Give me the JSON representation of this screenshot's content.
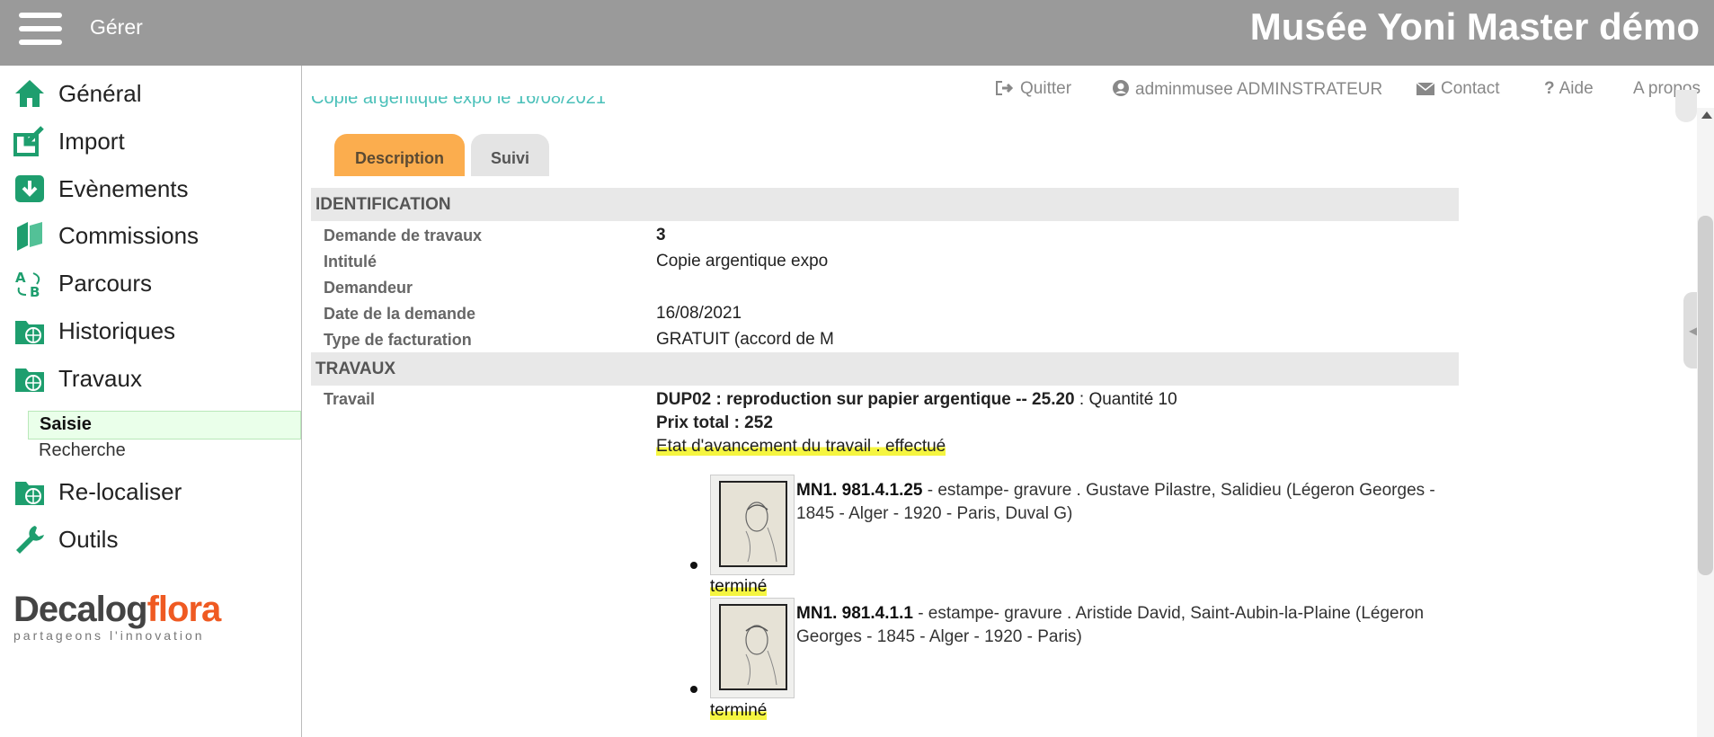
{
  "header": {
    "menu_label": "Gérer",
    "app_title": "Musée Yoni Master démo",
    "bar_color": "#9a9a9a"
  },
  "sidebar": {
    "items": [
      {
        "label": "Général",
        "icon": "home-icon"
      },
      {
        "label": "Import",
        "icon": "import-icon"
      },
      {
        "label": "Evènements",
        "icon": "download-box-icon"
      },
      {
        "label": "Commissions",
        "icon": "books-icon"
      },
      {
        "label": "Parcours",
        "icon": "route-ab-icon"
      },
      {
        "label": "Historiques",
        "icon": "folder-globe-icon"
      },
      {
        "label": "Travaux",
        "icon": "folder-globe-icon"
      },
      {
        "label": "Re-localiser",
        "icon": "folder-globe-icon"
      },
      {
        "label": "Outils",
        "icon": "wrench-icon"
      }
    ],
    "sub_items": [
      {
        "label": "Saisie",
        "active": true
      },
      {
        "label": "Recherche",
        "active": false
      }
    ],
    "accent_color": "#1e9e6e"
  },
  "logo": {
    "part1": "Decalog",
    "part2": "flora",
    "tagline": "partageons l'innovation"
  },
  "util_bar": {
    "quit": "Quitter",
    "user": "adminmusee ADMINSTRATEUR",
    "contact": "Contact",
    "help": "Aide",
    "about": "A propos"
  },
  "breadcrumb": "Copie argentique expo le 16/08/2021",
  "tabs": {
    "description": "Description",
    "suivi": "Suivi",
    "active_color": "#fbad4e"
  },
  "identification": {
    "title": "IDENTIFICATION",
    "fields": [
      {
        "label": "Demande de travaux",
        "value": "3"
      },
      {
        "label": "Intitulé",
        "value": "Copie argentique expo"
      },
      {
        "label": "Demandeur",
        "value": ""
      },
      {
        "label": "Date de la demande",
        "value": "16/08/2021"
      },
      {
        "label": "Type de facturation",
        "value": "GRATUIT (accord de M"
      }
    ]
  },
  "travaux": {
    "title": "TRAVAUX",
    "label": "Travail",
    "code": "DUP02 : reproduction sur papier argentique -- 25.20",
    "quantity": " : Quantité 10",
    "total": "Prix total : 252",
    "progress": "Etat d'avancement du travail : effectué",
    "objects": [
      {
        "inventory": "MN1. 981.4.1.25",
        "description": " - estampe- gravure . Gustave Pilastre, Salidieu (Légeron Georges - 1845 - Alger - 1920 - Paris, Duval G)",
        "status": "terminé"
      },
      {
        "inventory": "MN1. 981.4.1.1",
        "description": " - estampe- gravure . Aristide David, Saint-Aubin-la-Plaine (Légeron Georges - 1845 - Alger - 1920 - Paris)",
        "status": "terminé"
      }
    ]
  }
}
